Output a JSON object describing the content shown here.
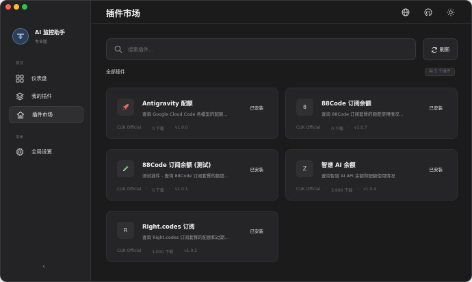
{
  "app": {
    "name": "AI 监控助手",
    "edition": "专业版"
  },
  "sidebar": {
    "section_home": "首页",
    "section_system": "系统",
    "items": [
      {
        "label": "仪表盘",
        "icon": "dashboard-icon"
      },
      {
        "label": "我的插件",
        "icon": "layers-icon"
      },
      {
        "label": "插件市场",
        "icon": "home-icon",
        "active": true
      },
      {
        "label": "全局设置",
        "icon": "gear-icon"
      }
    ],
    "collapse_glyph": "‹"
  },
  "header": {
    "title": "插件市场",
    "icons": [
      "globe-icon",
      "github-icon",
      "sun-icon"
    ]
  },
  "search": {
    "placeholder": "搜索插件..."
  },
  "refresh_label": "刷新",
  "section_title": "全部插件",
  "count_badge": "共 5 个插件",
  "plugins": [
    {
      "icon_text": "🚀",
      "name": "Antigravity 配额",
      "desc": "查询 Google Cloud Code 各模型的配额...",
      "status": "已安装",
      "author": "CUK Official",
      "downloads": "0 下载",
      "version": "v1.0.0"
    },
    {
      "icon_text": "8",
      "name": "88Code 订阅余额",
      "desc": "查询 88Code 订阅套餐的额度使用情况...",
      "status": "已安装",
      "author": "CUK Official",
      "downloads": "0 下载",
      "version": "v1.0.7"
    },
    {
      "icon_text": "✎",
      "name": "88Code 订阅余额 (测试)",
      "desc": "测试插件 - 查询 88Code 订阅套餐的额度...",
      "status": "已安装",
      "author": "CUK Official",
      "downloads": "0 下载",
      "version": "v1.0.1"
    },
    {
      "icon_text": "Z",
      "name": "智谱 AI 余额",
      "desc": "查询智谱 AI API 余额和配额使用情况",
      "status": "已安装",
      "author": "CUK Official",
      "downloads": "5,900 下载",
      "version": "v1.0.4"
    },
    {
      "icon_text": "R",
      "name": "Right.codes 订阅",
      "desc": "查询 Right.codes 订阅套餐的配额和过期...",
      "status": "已安装",
      "author": "CUK Official",
      "downloads": "1,000 下载",
      "version": "v1.0.2"
    }
  ],
  "meta_separator": "·"
}
